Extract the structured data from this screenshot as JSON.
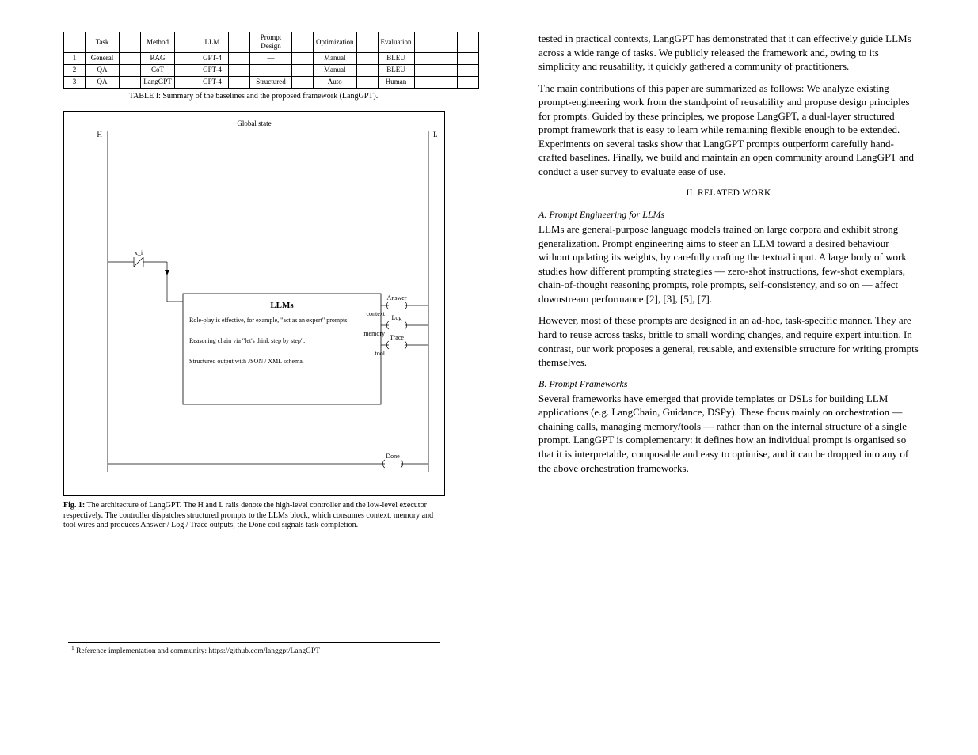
{
  "table": {
    "caption": "TABLE I: Summary of the baselines and the proposed framework (LangGPT).",
    "headers": [
      "",
      "Task",
      "",
      "Method",
      "",
      "LLM",
      "",
      "Prompt Design",
      "",
      "Optimization",
      "",
      "Evaluation",
      "",
      "",
      ""
    ],
    "rows": [
      [
        "1",
        "General",
        "",
        "RAG",
        "",
        "GPT-4",
        "",
        "—",
        "",
        "Manual",
        "",
        "BLEU",
        "",
        "",
        ""
      ],
      [
        "2",
        "QA",
        "",
        "CoT",
        "",
        "GPT-4",
        "",
        "—",
        "",
        "Manual",
        "",
        "BLEU",
        "",
        "",
        ""
      ],
      [
        "3",
        "QA",
        "",
        "LangGPT",
        "",
        "GPT-4",
        "",
        "Structured",
        "",
        "Auto",
        "",
        "Human",
        "",
        "",
        ""
      ]
    ]
  },
  "figure": {
    "top_label": "Global state",
    "bus_left": "H",
    "bus_right": "L",
    "block_title": "LLMs",
    "block_lines": [
      "Role-play is effective, for example, \"act as an expert\" prompts.",
      "",
      "Reasoning chain via \"let's think step by step\".",
      "",
      "Structured output with JSON / XML schema."
    ],
    "wire_labels": {
      "a": "context",
      "b": "memory",
      "c": "tool"
    },
    "coil_1": "Answer",
    "coil_2": "Log",
    "coil_3": "Trace",
    "bottom_coil": "Done",
    "small_xi": "x_i",
    "caption_bold": "Fig. 1:",
    "caption_text": " The architecture of LangGPT. The H and L rails denote the high-level controller and the low-level executor respectively. The controller dispatches structured prompts to the LLMs block, which consumes context, memory and tool wires and produces Answer / Log / Trace outputs; the Done coil signals task completion."
  },
  "right": {
    "p1": "tested in practical contexts, LangGPT has demonstrated that it can effectively guide LLMs across a wide range of tasks. We publicly released the framework and, owing to its simplicity and reusability, it quickly gathered a community of practitioners.",
    "p2": "The main contributions of this paper are summarized as follows: We analyze existing prompt-engineering work from the standpoint of reusability and propose design principles for prompts. Guided by these principles, we propose LangGPT, a dual-layer structured prompt framework that is easy to learn while remaining flexible enough to be extended. Experiments on several tasks show that LangGPT prompts outperform carefully hand-crafted baselines. Finally, we build and maintain an open community around LangGPT and conduct a user survey to evaluate ease of use.",
    "sec_head": "II.   RELATED WORK",
    "sub1_head": "A. Prompt Engineering for LLMs",
    "sub1_body": "LLMs are general-purpose language models trained on large corpora and exhibit strong generalization. Prompt engineering aims to steer an LLM toward a desired behaviour without updating its weights, by carefully crafting the textual input. A large body of work studies how different prompting strategies — zero-shot instructions, few-shot exemplars, chain-of-thought reasoning prompts, role prompts, self-consistency, and so on — affect downstream performance [2], [3], [5], [7].",
    "sub1_body2": "However, most of these prompts are designed in an ad-hoc, task-specific manner. They are hard to reuse across tasks, brittle to small wording changes, and require expert intuition. In contrast, our work proposes a general, reusable, and extensible structure for writing prompts themselves.",
    "sub2_head": "B. Prompt Frameworks",
    "sub2_body": "Several frameworks have emerged that provide templates or DSLs for building LLM applications (e.g. LangChain, Guidance, DSPy). These focus mainly on orchestration — chaining calls, managing memory/tools — rather than on the internal structure of a single prompt. LangGPT is complementary: it defines how an individual prompt is organised so that it is interpretable, composable and easy to optimise, and it can be dropped into any of the above orchestration frameworks."
  },
  "footnote": {
    "marker": "1",
    "text": "Reference implementation and community: https://github.com/langgpt/LangGPT"
  }
}
